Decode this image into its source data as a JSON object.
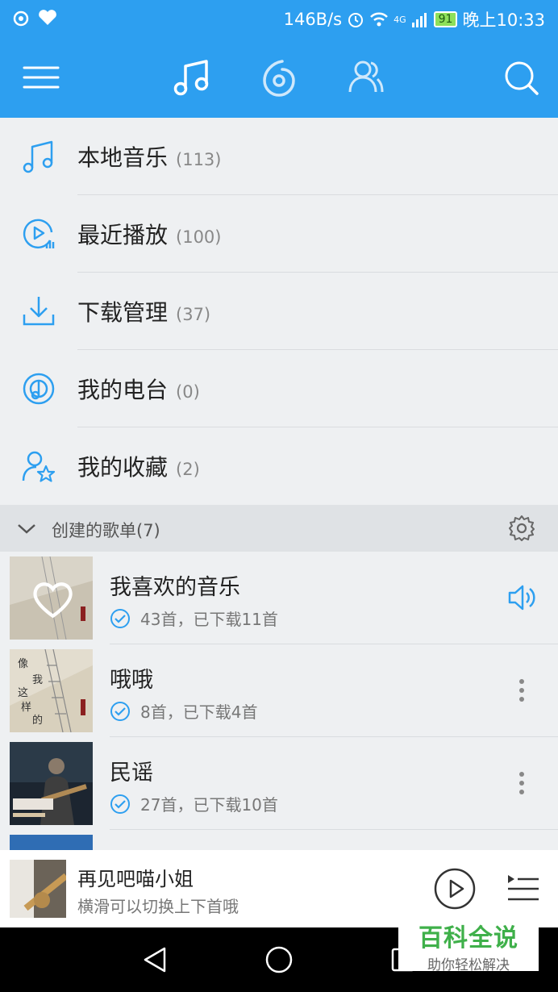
{
  "status_bar": {
    "network_speed": "146B/s",
    "network_type": "4G",
    "battery": "91",
    "time": "晚上10:33"
  },
  "nav": {
    "icons": [
      "menu-icon",
      "music-note-icon",
      "netease-radio-icon",
      "friends-icon",
      "search-icon"
    ]
  },
  "menu": [
    {
      "label": "本地音乐",
      "count": "(113)",
      "icon": "music-note-icon"
    },
    {
      "label": "最近播放",
      "count": "(100)",
      "icon": "recent-play-icon"
    },
    {
      "label": "下载管理",
      "count": "(37)",
      "icon": "download-icon"
    },
    {
      "label": "我的电台",
      "count": "(0)",
      "icon": "radio-icon"
    },
    {
      "label": "我的收藏",
      "count": "(2)",
      "icon": "favorite-user-icon"
    }
  ],
  "section": {
    "title": "创建的歌单(7)"
  },
  "playlists": [
    {
      "name": "我喜欢的音乐",
      "info": "43首，已下载11首",
      "action": "speaker-icon"
    },
    {
      "name": "哦哦",
      "info": "8首，已下载4首",
      "action": "more-icon"
    },
    {
      "name": "民谣",
      "info": "27首，已下载10首",
      "action": "more-icon"
    }
  ],
  "now_playing": {
    "title": "再见吧喵小姐",
    "subtitle": "横滑可以切换上下首哦"
  },
  "watermark": {
    "title": "百科全说",
    "subtitle": "助你轻松解决"
  },
  "colors": {
    "accent": "#2d9ff0",
    "background": "#eef0f2",
    "watermark_green": "#3fb04a"
  }
}
